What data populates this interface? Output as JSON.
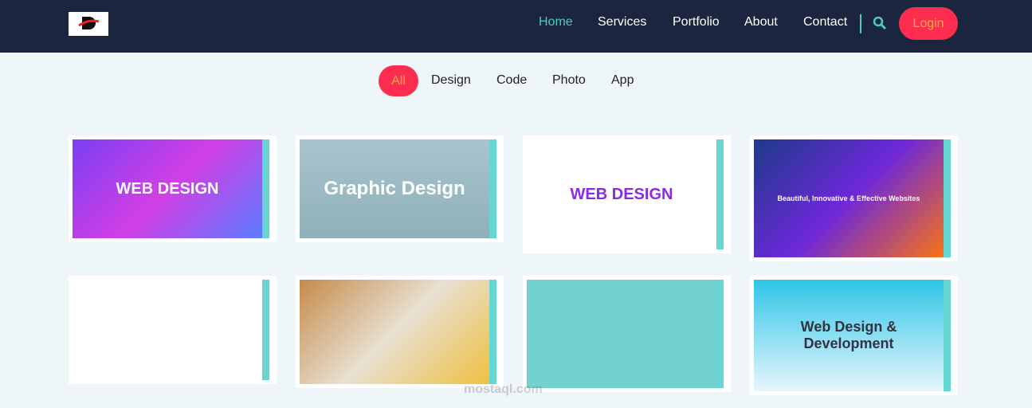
{
  "nav": {
    "items": [
      "Home",
      "Services",
      "Portfolio",
      "About",
      "Contact"
    ],
    "active": "Home",
    "login": "Login"
  },
  "filters": {
    "items": [
      "All",
      "Design",
      "Code",
      "Photo",
      "App"
    ],
    "active": "All"
  },
  "colors": {
    "nav_bg": "#1b263e",
    "accent": "#4ec9c9",
    "button": "#fd2d4f",
    "button_text": "#ffa94d",
    "strip": "#66d6d3"
  },
  "portfolio": [
    {
      "label": "WEB DESIGN"
    },
    {
      "label": "Graphic Design"
    },
    {
      "label": "WEB DESIGN"
    },
    {
      "label": "Beautiful, Innovative & Effective Websites"
    },
    {
      "label": ""
    },
    {
      "label": ""
    },
    {
      "label": ""
    },
    {
      "label": "Web Design & Development"
    }
  ],
  "watermark": "mostaql.com"
}
